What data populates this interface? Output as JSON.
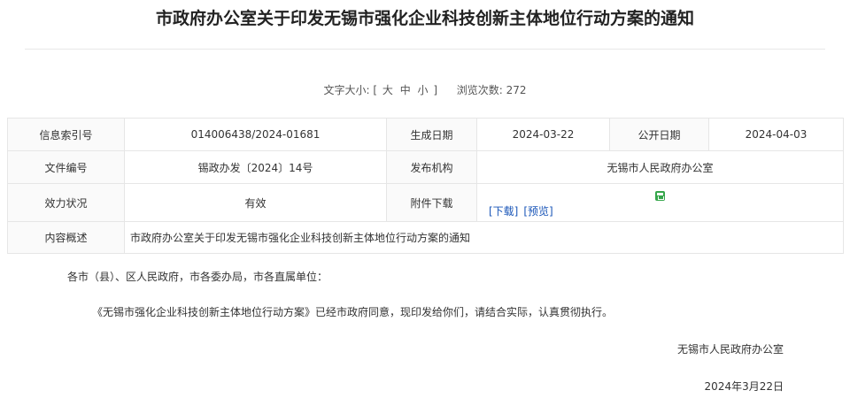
{
  "title": "市政府办公室关于印发无锡市强化企业科技创新主体地位行动方案的通知",
  "meta": {
    "font_size_label": "文字大小:",
    "bracket_open": "[",
    "size_large": "大",
    "size_medium": "中",
    "size_small": "小",
    "bracket_close": "]",
    "views_label": "浏览次数:",
    "views_count": "272"
  },
  "info": {
    "index_label": "信息索引号",
    "index_value": "014006438/2024-01681",
    "created_label": "生成日期",
    "created_value": "2024-03-22",
    "public_label": "公开日期",
    "public_value": "2024-04-03",
    "doc_no_label": "文件编号",
    "doc_no_value": "锡政办发〔2024〕14号",
    "issuer_label": "发布机构",
    "issuer_value": "无锡市人民政府办公室",
    "validity_label": "效力状况",
    "validity_value": "有效",
    "attachment_label": "附件下载",
    "download_link": "[下载]",
    "preview_link": "[预览]",
    "summary_label": "内容概述",
    "summary_value": "市政府办公室关于印发无锡市强化企业科技创新主体地位行动方案的通知"
  },
  "body": {
    "salutation": "各市（县）、区人民政府，市各委办局，市各直属单位：",
    "paragraph": "《无锡市强化企业科技创新主体地位行动方案》已经市政府同意，现印发给你们，请结合实际，认真贯彻执行。",
    "signature_org": "无锡市人民政府办公室",
    "signature_date": "2024年3月22日"
  },
  "colors": {
    "link": "#1a56b8",
    "attachment_icon": "#35a64a"
  }
}
